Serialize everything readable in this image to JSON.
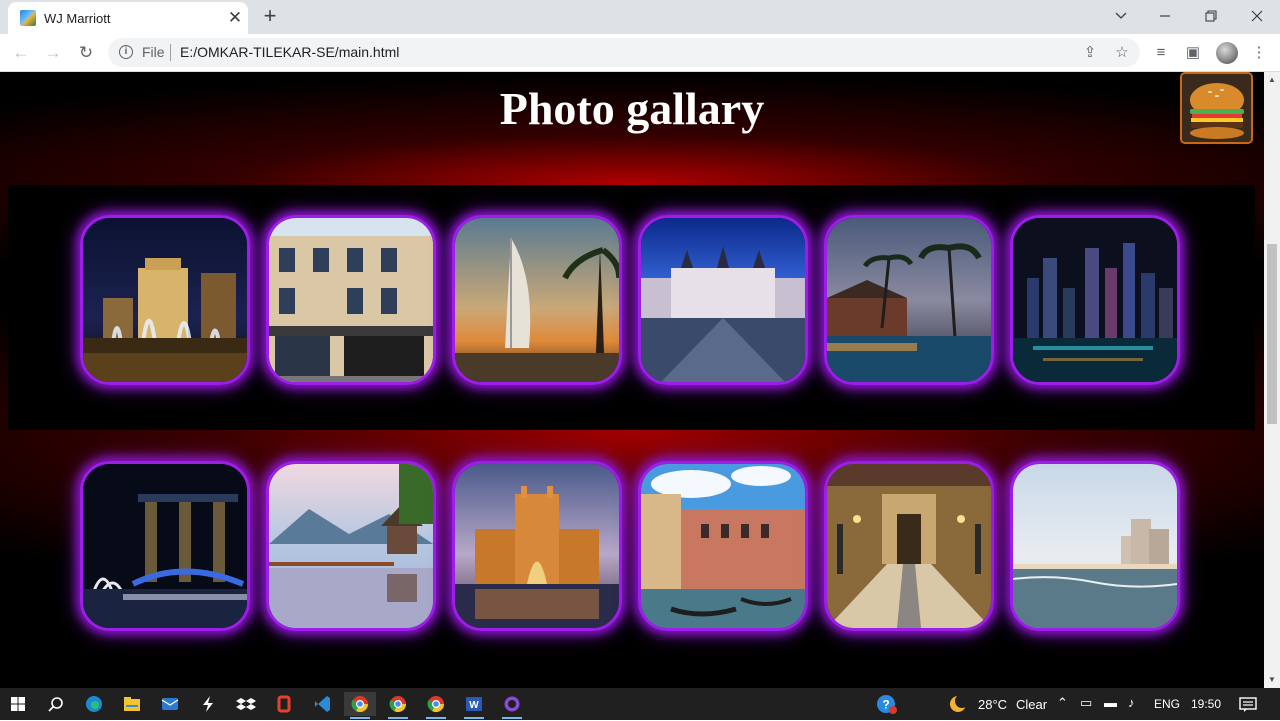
{
  "browser": {
    "tab_title": "WJ Marriott",
    "scheme": "File",
    "url": "E:/OMKAR-TILEKAR-SE/main.html"
  },
  "page": {
    "title": "Photo gallary",
    "accent_color": "#9b1fe8",
    "glow_color": "#b00000",
    "photos_row1": [
      {
        "scene": "Bellagio fountains at night"
      },
      {
        "scene": "Hotel restaurant facade"
      },
      {
        "scene": "Burj Al Arab at sunset"
      },
      {
        "scene": "Castle courtyard at dusk"
      },
      {
        "scene": "Tropical resort pool"
      },
      {
        "scene": "Night skyline over water"
      }
    ],
    "photos_row2": [
      {
        "scene": "Marina Bay Sands at night"
      },
      {
        "scene": "Lake house reflection"
      },
      {
        "scene": "Atlantis resort at night"
      },
      {
        "scene": "Venetian canal with gondolas"
      },
      {
        "scene": "Palace hallway"
      },
      {
        "scene": "Beach with high-rise hotel"
      }
    ]
  },
  "taskbar": {
    "weather_temp": "28°C",
    "weather_desc": "Clear",
    "language": "ENG",
    "time": "19:50"
  }
}
